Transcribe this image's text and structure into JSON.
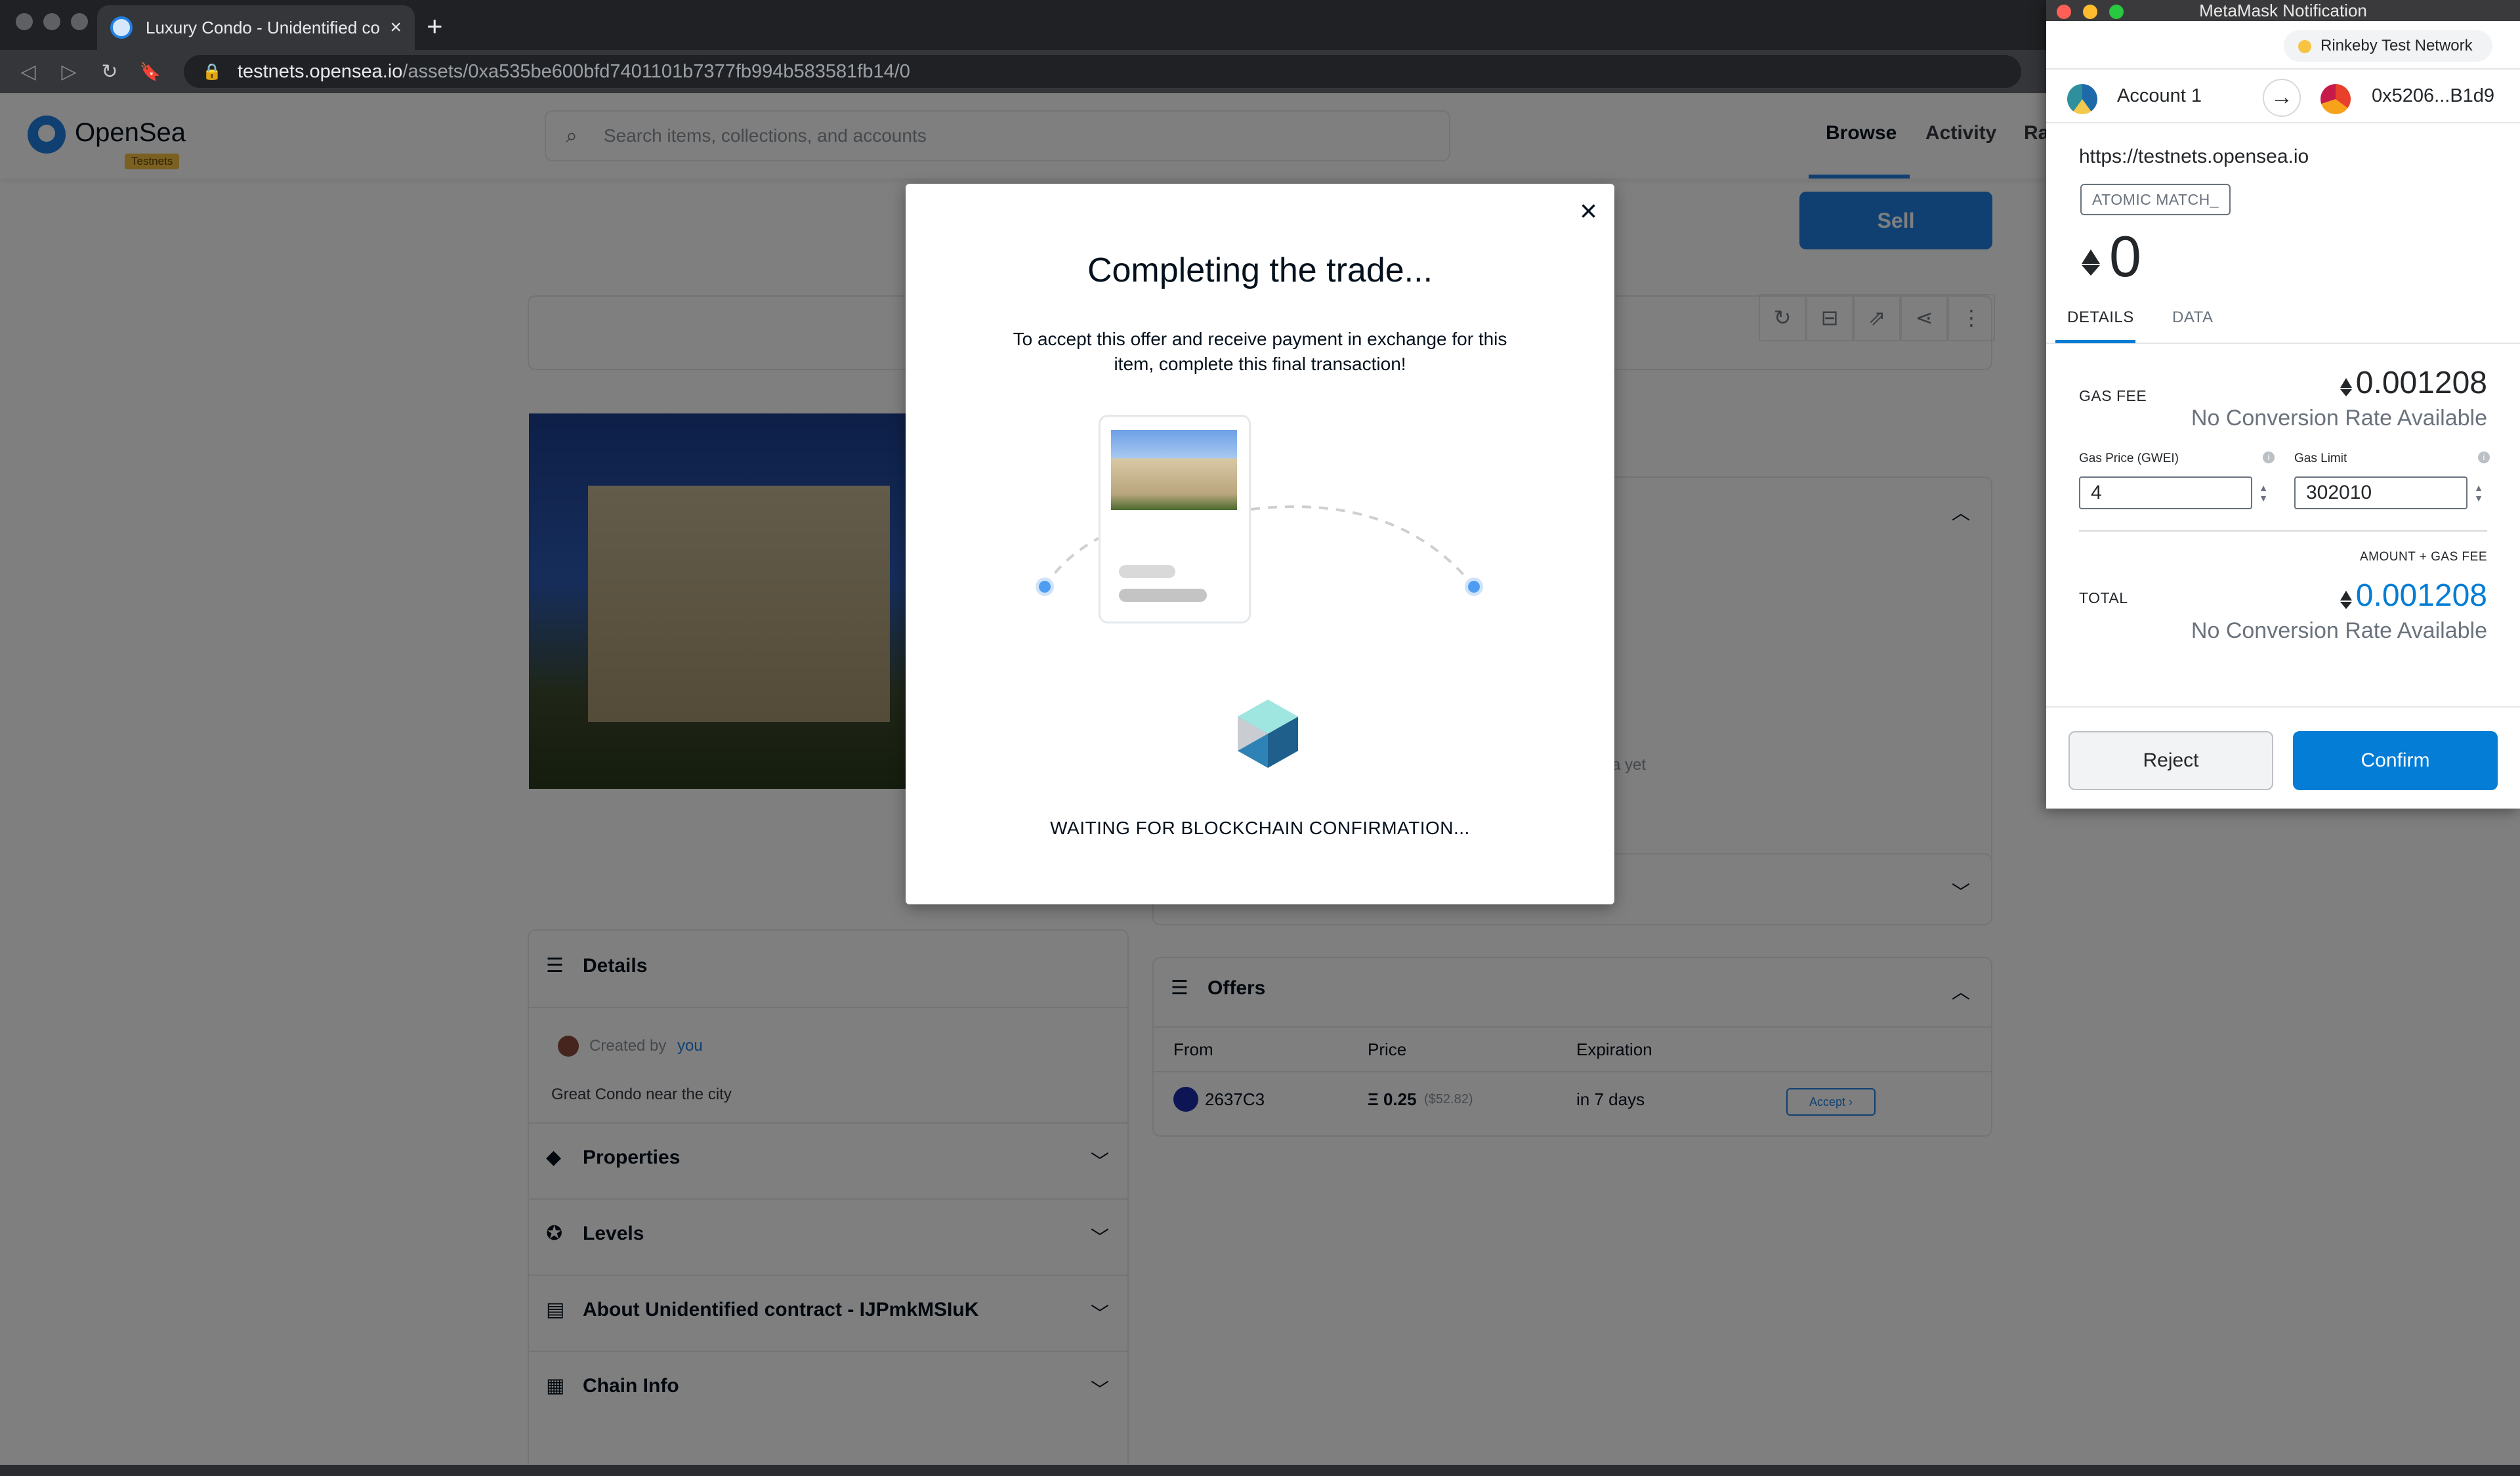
{
  "browser": {
    "tab_title": "Luxury Condo - Unidentified co",
    "tab_close": "×",
    "new_tab": "+",
    "url_host": "testnets.opensea.io",
    "url_path": "/assets/0xa535be600bfd7401101b7377fb994b583581fb14/0",
    "nav_back": "◁",
    "nav_forward": "▷",
    "nav_reload": "↻",
    "nav_bookmark": "🔖",
    "lock_icon": "🔒"
  },
  "opensea": {
    "brand": "OpenSea",
    "badge": "Testnets",
    "search_placeholder": "Search items, collections, and accounts",
    "nav_browse": "Browse",
    "nav_activity": "Activity",
    "nav_ra": "Ra",
    "sell_button": "Sell",
    "details_title": "Details",
    "created_by_prefix": "Created by",
    "created_by_user": "you",
    "description": "Great Condo near the city",
    "properties_title": "Properties",
    "levels_title": "Levels",
    "about_title": "About Unidentified contract - IJPmkMSIuK",
    "chain_info_title": "Chain Info",
    "offers_title": "Offers",
    "offers_headers": [
      "From",
      "Price",
      "Expiration"
    ],
    "offer_row": {
      "from": "2637C3",
      "price": "Ξ 0.25",
      "price_usd": "($52.82)",
      "expiration": "in 7 days",
      "accept": "Accept"
    },
    "no_data_text": "a yet"
  },
  "modal": {
    "title": "Completing the trade...",
    "description": "To accept this offer and receive payment in exchange for this item, complete this final transaction!",
    "status": "WAITING FOR BLOCKCHAIN CONFIRMATION...",
    "close": "×"
  },
  "metamask": {
    "window_title": "MetaMask Notification",
    "network": "Rinkeby Test Network",
    "account_from": "Account 1",
    "account_to": "0x5206...B1d9",
    "origin": "https://testnets.opensea.io",
    "method": "ATOMIC MATCH_",
    "amount": "0",
    "tab_details": "DETAILS",
    "tab_data": "DATA",
    "gas_fee_label": "GAS FEE",
    "gas_fee_value": "0.001208",
    "no_conversion": "No Conversion Rate Available",
    "gas_price_label": "Gas Price (GWEI)",
    "gas_price_value": "4",
    "gas_limit_label": "Gas Limit",
    "gas_limit_value": "302010",
    "amount_gas_fee_label": "AMOUNT + GAS FEE",
    "total_label": "TOTAL",
    "total_value": "0.001208",
    "reject": "Reject",
    "confirm": "Confirm",
    "colors": {
      "accent": "#037dd6"
    }
  }
}
